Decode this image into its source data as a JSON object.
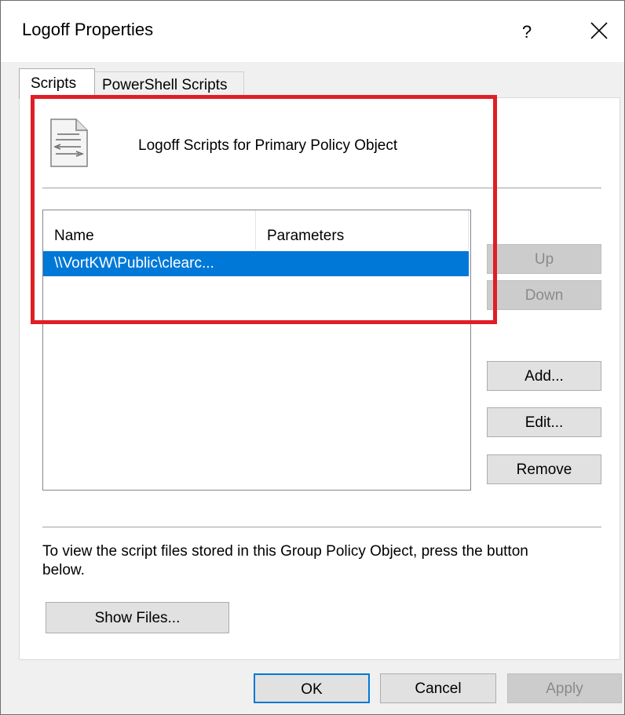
{
  "window": {
    "title": "Logoff Properties",
    "help_label": "?",
    "close_icon": "close-icon"
  },
  "tabs": [
    {
      "label": "Scripts",
      "selected": true
    },
    {
      "label": "PowerShell Scripts",
      "selected": false
    }
  ],
  "panel": {
    "icon": "script-file-icon",
    "heading": "Logoff Scripts for Primary Policy Object",
    "list": {
      "columns": [
        "Name",
        "Parameters"
      ],
      "rows": [
        {
          "name": "\\\\VortKW\\Public\\clearc...",
          "parameters": "",
          "selected": true
        }
      ]
    },
    "buttons": {
      "up": "Up",
      "down": "Down",
      "add": "Add...",
      "edit": "Edit...",
      "remove": "Remove"
    },
    "info_text": "To view the script files stored in this Group Policy Object, press the button below.",
    "show_files": "Show Files..."
  },
  "footer": {
    "ok": "OK",
    "cancel": "Cancel",
    "apply": "Apply"
  },
  "colors": {
    "selection": "#0078d7",
    "highlight_box": "#e01e26"
  }
}
